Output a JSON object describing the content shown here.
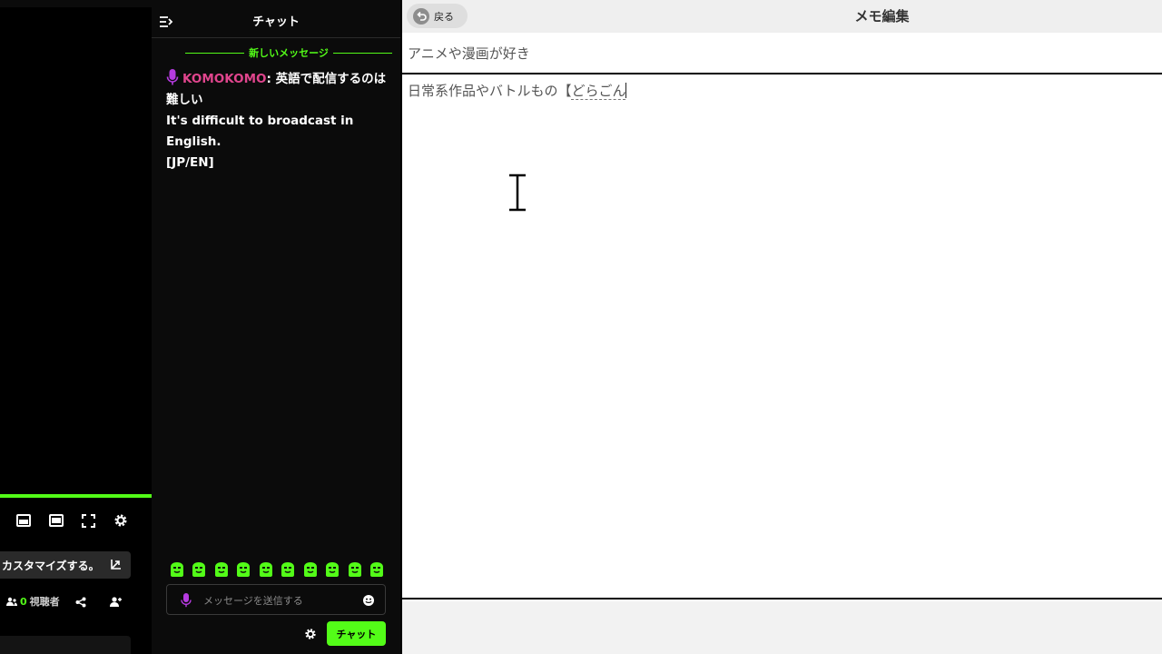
{
  "player": {
    "controls": [
      {
        "name": "theater-mode-icon"
      },
      {
        "name": "mini-player-icon"
      },
      {
        "name": "fullscreen-icon"
      },
      {
        "name": "settings-icon"
      }
    ],
    "customize_label": "カスタマイズする。",
    "viewer_count": "0",
    "viewer_label": "視聴者",
    "accent_color": "#53fc18"
  },
  "chat": {
    "title": "チャット",
    "new_messages_label": "新しいメッセージ",
    "messages": [
      {
        "username": "KOMOKOMO",
        "separator": ": ",
        "text": "英語で配信するのは難しい",
        "translation": "It's difficult to broadcast in English.",
        "tag": "[JP/EN]"
      }
    ],
    "username_color": "#e0458d",
    "input_placeholder": "メッセージを送信する",
    "send_label": "チャット",
    "emote_count": 10
  },
  "memo": {
    "back_label": "戻る",
    "title": "メモ編集",
    "title_value": "アニメや漫画が好き",
    "body_committed": "日常系作品やバトルもの【",
    "body_composing": "どらごん"
  }
}
